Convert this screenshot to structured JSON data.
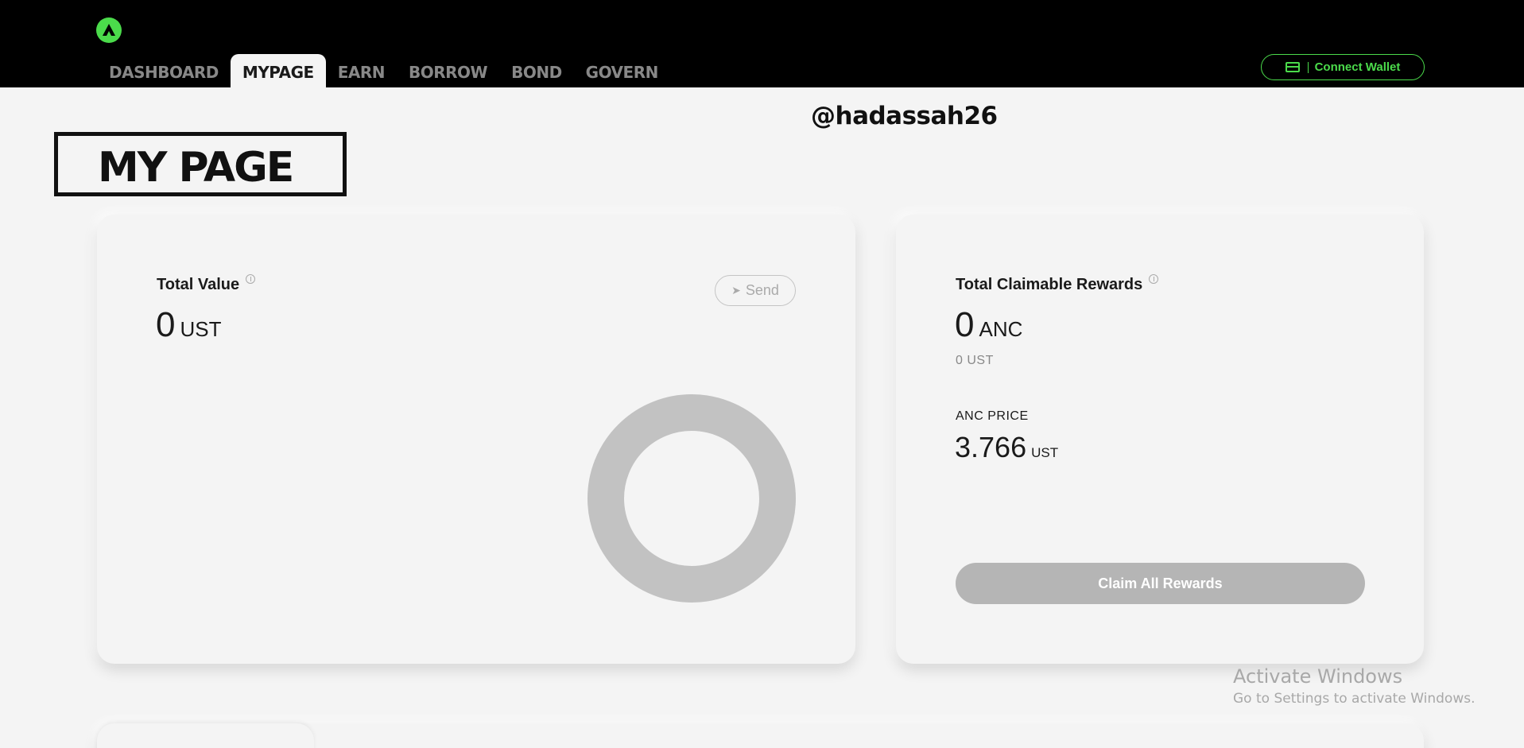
{
  "header": {
    "nav": [
      "DASHBOARD",
      "MYPAGE",
      "EARN",
      "BORROW",
      "BOND",
      "GOVERN"
    ],
    "active_tab": "MYPAGE",
    "wallet_label": "Connect Wallet",
    "accent_color": "#4bdb4b"
  },
  "username": "@hadassah26",
  "page_title": "MY PAGE",
  "total_value": {
    "label": "Total Value",
    "value": "0",
    "unit": "UST",
    "send_label": "Send"
  },
  "rewards": {
    "label": "Total Claimable Rewards",
    "value": "0",
    "unit": "ANC",
    "sub_value": "0 UST",
    "price_label": "ANC PRICE",
    "price_value": "3.766",
    "price_unit": "UST",
    "claim_label": "Claim All Rewards"
  },
  "watermark": {
    "title": "Activate Windows",
    "subtitle": "Go to Settings to activate Windows."
  }
}
